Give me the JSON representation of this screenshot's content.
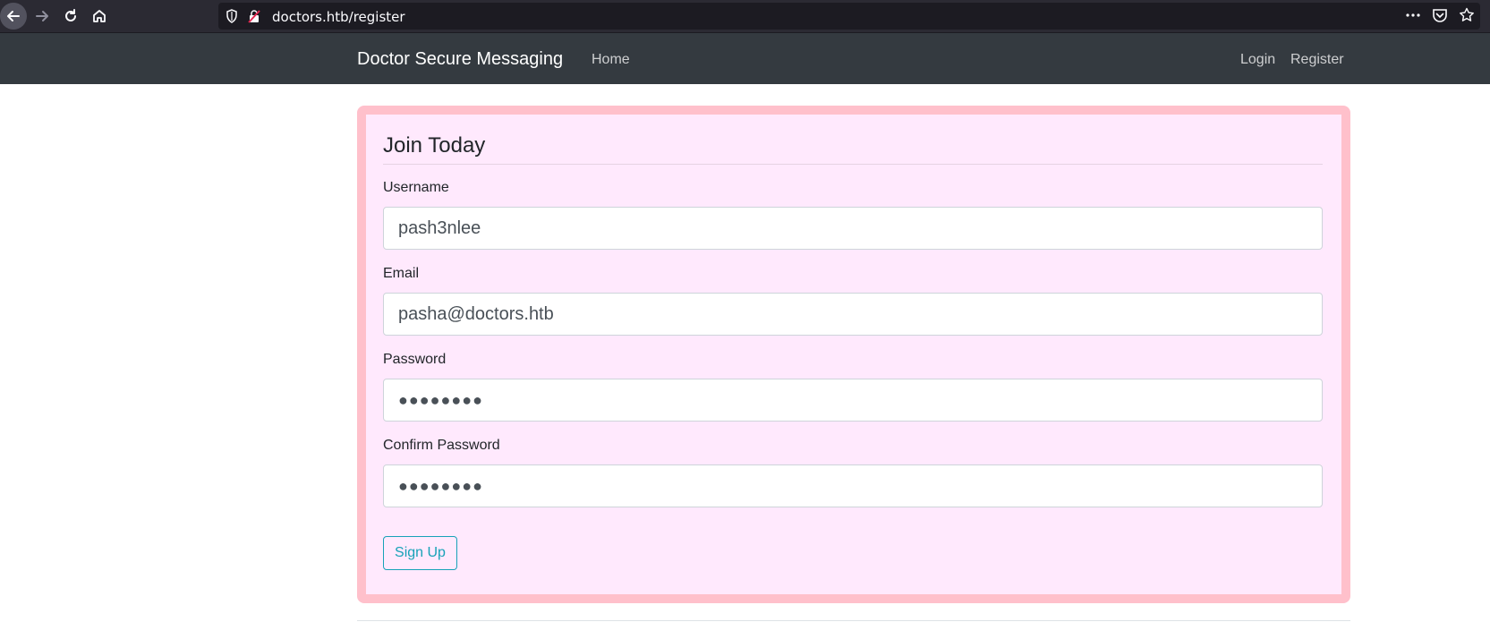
{
  "browser": {
    "url": "doctors.htb/register",
    "colors": {
      "toolbar_bg": "#2b2a33",
      "url_bg": "#1c1b22",
      "url_text": "#fbfbfe"
    },
    "icons": [
      "back-arrow-icon",
      "forward-arrow-icon",
      "reload-icon",
      "home-icon",
      "shield-icon",
      "insecure-lock-icon",
      "more-actions-icon",
      "pocket-icon",
      "bookmark-star-icon"
    ]
  },
  "navbar": {
    "brand": "Doctor Secure Messaging",
    "home": "Home",
    "login": "Login",
    "register": "Register",
    "colors": {
      "background": "#343a40"
    }
  },
  "form": {
    "legend": "Join Today",
    "fields": [
      {
        "label": "Username",
        "value": "pash3nlee",
        "type": "text"
      },
      {
        "label": "Email",
        "value": "pasha@doctors.htb",
        "type": "email"
      },
      {
        "label": "Password",
        "value": "●●●●●●●●",
        "type": "password"
      },
      {
        "label": "Confirm Password",
        "value": "●●●●●●●●",
        "type": "password"
      }
    ],
    "submit": "Sign Up",
    "colors": {
      "card_bg": "#ffe9fd",
      "card_border": "#ffc0cb",
      "button": "#17a2b8"
    }
  }
}
